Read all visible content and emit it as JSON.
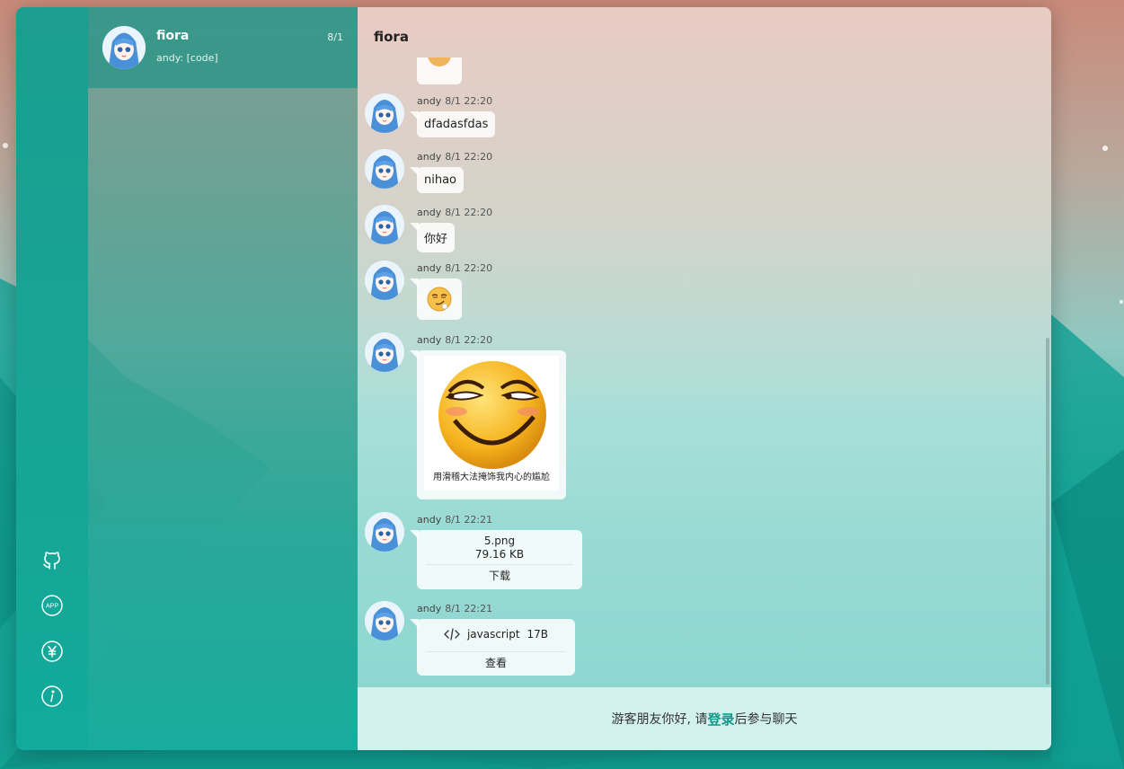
{
  "sidebar": {
    "icons": [
      "github-icon",
      "app-icon",
      "yen-icon",
      "info-icon"
    ],
    "app_label": "APP"
  },
  "linkman": {
    "name": "fiora",
    "time": "8/1",
    "preview": "andy: [code]"
  },
  "chat": {
    "title": "fiora",
    "messages": [
      {
        "user": "andy",
        "time": "8/1 22:20",
        "text": "dfadasfdas"
      },
      {
        "user": "andy",
        "time": "8/1 22:20",
        "text": "nihao"
      },
      {
        "user": "andy",
        "time": "8/1 22:20",
        "text": "你好"
      },
      {
        "user": "andy",
        "time": "8/1 22:20",
        "type": "expression"
      },
      {
        "user": "andy",
        "time": "8/1 22:20",
        "type": "image",
        "caption": "用滑稽大法掩饰我内心的尴尬"
      },
      {
        "user": "andy",
        "time": "8/1 22:21",
        "type": "file",
        "file_name": "5.png",
        "file_size": "79.16 KB",
        "action": "下载"
      },
      {
        "user": "andy",
        "time": "8/1 22:21",
        "type": "code",
        "language": "javascript",
        "size": "17B",
        "action": "查看"
      }
    ]
  },
  "footer": {
    "prefix": "游客朋友你好, 请",
    "login": "登录",
    "suffix": "后参与聊天"
  },
  "colors": {
    "accent": "#129a8b",
    "sidebar": "#17a596"
  }
}
